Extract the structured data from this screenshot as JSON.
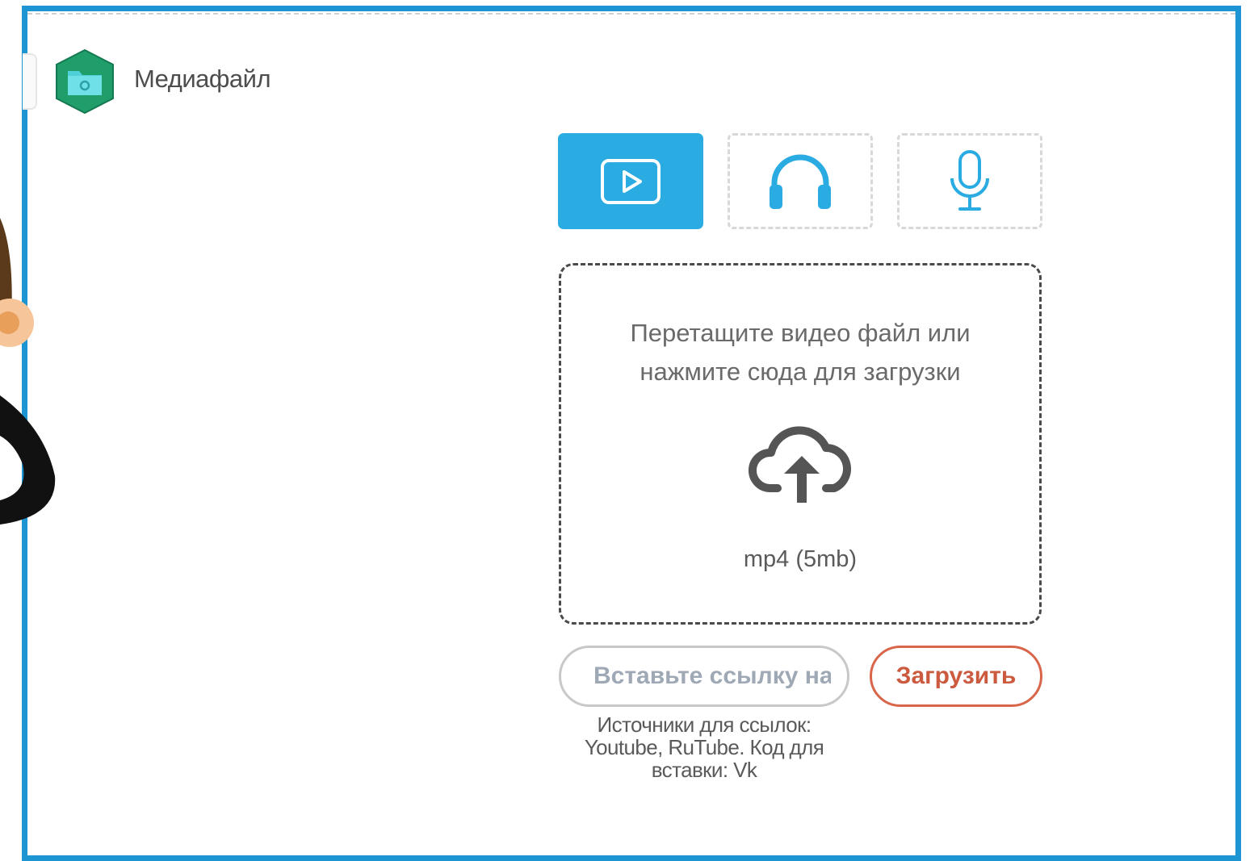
{
  "app": {
    "title": "Медиафайл",
    "logo_icon": "folder-hexagon-logo"
  },
  "media_types": [
    {
      "id": "video",
      "icon": "video-play-icon",
      "active": true
    },
    {
      "id": "audio",
      "icon": "headphones-icon",
      "active": false
    },
    {
      "id": "voice",
      "icon": "microphone-icon",
      "active": false
    }
  ],
  "dropzone": {
    "line1": "Перетащите видео файл или",
    "line2": "нажмите сюда для загрузки",
    "icon": "cloud-upload-icon",
    "format": "mp4 (5mb)"
  },
  "link": {
    "placeholder": "Вставьте ссылку на видео",
    "value": "",
    "visible_text": "Вставьте ссылку н"
  },
  "upload_button": {
    "label": "Загрузить"
  },
  "sources": {
    "line1": "Источники для ссылок:",
    "line2": "Youtube, RuTube. Код для",
    "line3": "вставки: Vk"
  },
  "colors": {
    "frame": "#1d95d3",
    "active_tab": "#2aabe2",
    "icon_blue": "#2aabe2",
    "upload_accent": "#d9654a",
    "logo_green": "#1f9e6a",
    "logo_teal": "#4fd0d8"
  }
}
